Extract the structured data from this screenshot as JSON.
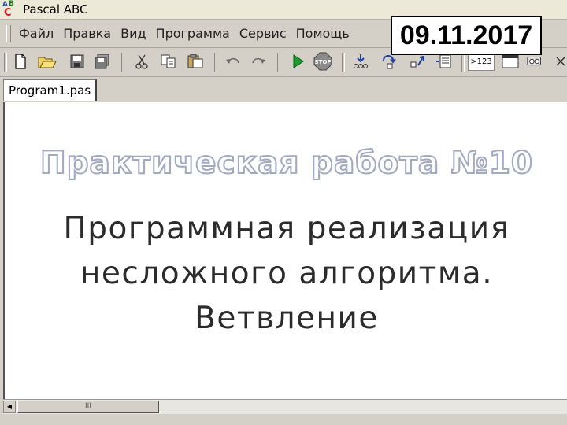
{
  "window": {
    "title": "Pascal ABC"
  },
  "menu": [
    "Файл",
    "Правка",
    "Вид",
    "Программа",
    "Сервис",
    "Помощь"
  ],
  "date_label": "09.11.2017",
  "toolbar": {
    "icons": [
      "new-file-icon",
      "open-folder-icon",
      "save-icon",
      "save-all-icon",
      "cut-icon",
      "copy-icon",
      "paste-icon",
      "undo-icon",
      "redo-icon",
      "run-icon",
      "stop-icon",
      "step-into-icon",
      "step-over-icon",
      "step-out-icon",
      "watch-icon",
      "debug-output-icon",
      "window-icon",
      "tools-icon",
      "close-icon"
    ],
    "debug_label": ">123"
  },
  "tab": {
    "label": "Program1.pas"
  },
  "slide": {
    "title": "Практическая работа №10",
    "subtitle_lines": [
      "Программная реализация",
      "несложного алгоритма.",
      "Ветвление"
    ]
  },
  "scrollbar": {
    "thumb_grip": "III"
  },
  "colors": {
    "run_green": "#1e9e2e",
    "stop_red": "#8a8a8a",
    "title_outline": "#a2a9c2"
  }
}
